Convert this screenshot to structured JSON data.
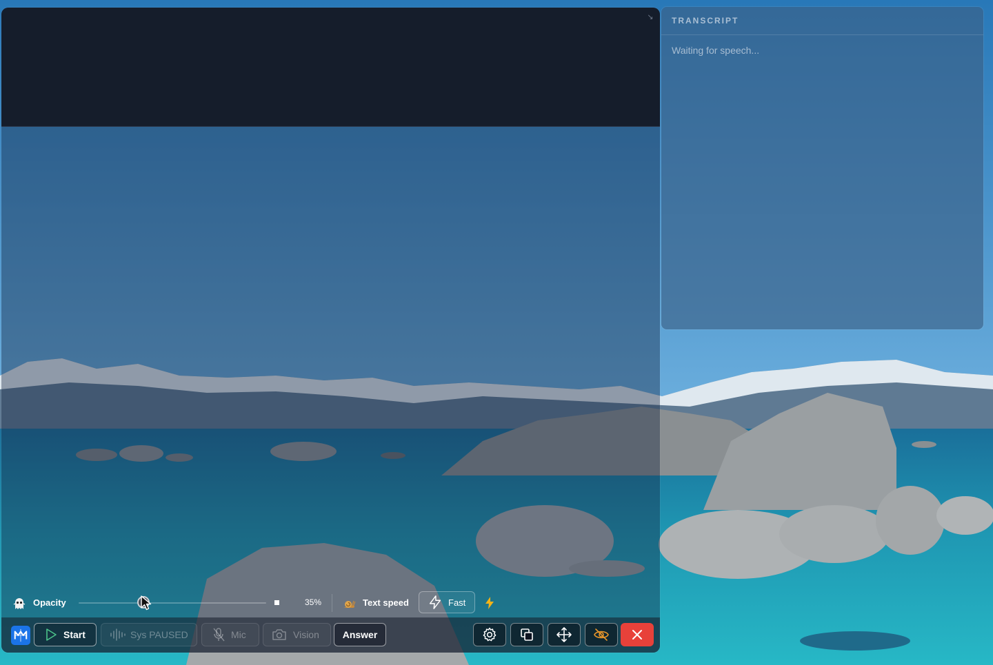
{
  "transcript": {
    "title": "TRANSCRIPT",
    "placeholder": "Waiting for speech..."
  },
  "controls": {
    "opacity_label": "Opacity",
    "opacity_value": "35%",
    "opacity_fraction": 0.35,
    "text_speed_label": "Text speed",
    "fast_label": "Fast"
  },
  "toolbar": {
    "start_label": "Start",
    "sys_label": "Sys PAUSED",
    "mic_label": "Mic",
    "vision_label": "Vision",
    "answer_label": "Answer"
  },
  "icons": {
    "logo": "app-logo-icon",
    "opacity": "ghost-icon",
    "speed": "snail-icon",
    "fast": "lightning-outline-icon",
    "turbo": "lightning-icon",
    "start": "play-icon",
    "sys": "waveform-icon",
    "mic": "mic-off-icon",
    "vision": "camera-icon",
    "settings": "gear-icon",
    "layers": "layers-icon",
    "move": "move-arrows-icon",
    "hide": "eye-slash-icon",
    "close": "close-icon"
  },
  "colors": {
    "close_button": "#e8413a",
    "logo_bg": "#1b74e8",
    "hide_icon": "#e8962a"
  }
}
